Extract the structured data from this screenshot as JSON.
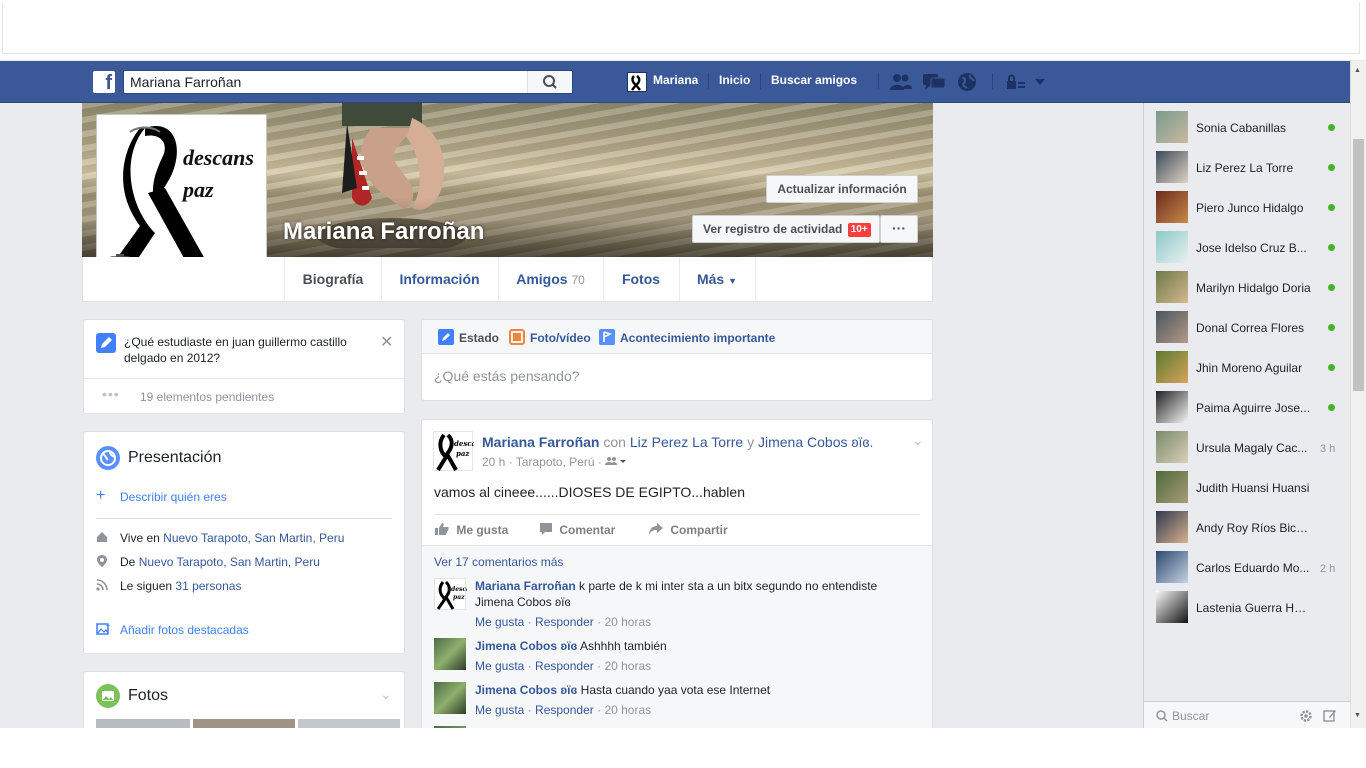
{
  "browser": {
    "blank_top": ""
  },
  "topbar": {
    "search_value": "Mariana Farroñan",
    "user_name": "Mariana",
    "home_label": "Inicio",
    "find_friends_label": "Buscar amigos"
  },
  "profile": {
    "name": "Mariana Farroñan",
    "propic_text_1": "descans",
    "propic_text_2": "paz",
    "update_info_label": "Actualizar información",
    "activity_log_label": "Ver registro de actividad",
    "activity_badge": "10+",
    "more_dots": "···"
  },
  "tabs": {
    "biography": "Biografía",
    "information": "Información",
    "friends": "Amigos",
    "friends_count": "70",
    "photos": "Fotos",
    "more": "Más"
  },
  "question_card": {
    "question": "¿Qué estudiaste en juan guillermo castillo delgado en 2012?",
    "pending": "19 elementos pendientes"
  },
  "intro": {
    "title": "Presentación",
    "describe": "Describir quién eres",
    "lives_prefix": "Vive en",
    "lives_place": "Nuevo Tarapoto, San Martin, Peru",
    "from_prefix": "De",
    "from_place": "Nuevo Tarapoto, San Martin, Peru",
    "followers_prefix": "Le siguen",
    "followers_count": "31 personas",
    "add_photos": "Añadir fotos destacadas"
  },
  "photos_card": {
    "title": "Fotos"
  },
  "composer": {
    "status_label": "Estado",
    "photo_label": "Foto/vídeo",
    "event_label": "Acontecimiento importante",
    "placeholder": "¿Qué estás pensando?"
  },
  "post": {
    "author": "Mariana Farroñan",
    "with_text": "con",
    "tagged_1": "Liz Perez La Torre",
    "and_text": "y",
    "tagged_2": "Jimena Cobos ʚïɞ.",
    "meta_time": "20 h · Tarapoto, Perú ·",
    "text": "vamos al cineee......DIOSES DE EGIPTO...hablen",
    "like_label": "Me gusta",
    "comment_label": "Comentar",
    "share_label": "Compartir",
    "more_comments": "Ver 17 comentarios más",
    "comments": [
      {
        "author": "Mariana Farroñan",
        "text": "k parte de k mi inter sta a un bitx segundo no entendiste",
        "mention": "Jimena Cobos ʚïɞ",
        "like": "Me gusta",
        "reply": "Responder",
        "time": "20 horas"
      },
      {
        "author": "Jimena Cobos ʚïɞ",
        "text": "Ashhhh también",
        "like": "Me gusta",
        "reply": "Responder",
        "time": "20 horas"
      },
      {
        "author": "Jimena Cobos ʚïɞ",
        "text": "Hasta cuando yaa vota ese Internet",
        "like": "Me gusta",
        "reply": "Responder",
        "time": "20 horas"
      }
    ]
  },
  "chat": {
    "contacts": [
      {
        "name": "Sonia Cabanillas",
        "status": "online"
      },
      {
        "name": "Liz Perez La Torre",
        "status": "online"
      },
      {
        "name": "Piero Junco Hidalgo",
        "status": "online"
      },
      {
        "name": "Jose Idelso Cruz B...",
        "status": "online"
      },
      {
        "name": "Marilyn Hidalgo Doria",
        "status": "online"
      },
      {
        "name": "Donal Correa Flores",
        "status": "online"
      },
      {
        "name": "Jhin Moreno Aguilar",
        "status": "online"
      },
      {
        "name": "Paima Aguirre Jose...",
        "status": "online"
      },
      {
        "name": "Ursula Magaly Cac...",
        "time": "3 h"
      },
      {
        "name": "Judith Huansi Huansi"
      },
      {
        "name": "Andy Roy Ríos Bicerra"
      },
      {
        "name": "Carlos Eduardo Mo...",
        "time": "2 h"
      },
      {
        "name": "Lastenia Guerra Huansi"
      }
    ],
    "search_placeholder": "Buscar"
  },
  "colors": {
    "brand": "#3b5998",
    "link": "#365899",
    "online": "#42b72a",
    "badge": "#fa3e3e"
  }
}
